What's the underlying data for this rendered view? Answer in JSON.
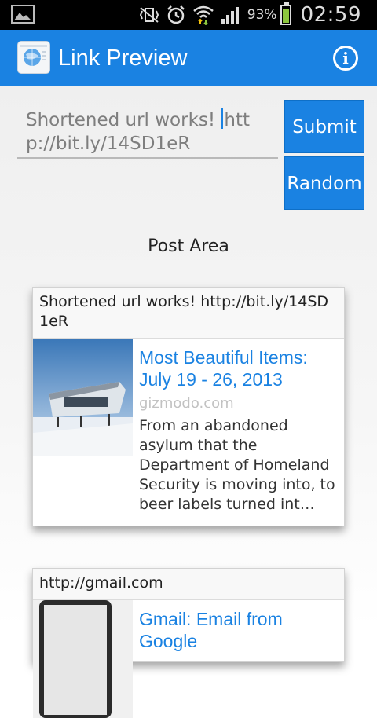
{
  "status_bar": {
    "battery_percent": "93%",
    "time": "02:59"
  },
  "action_bar": {
    "title": "Link Preview"
  },
  "form": {
    "input_value": "Shortened url works! http://bit.ly/14SD1eR",
    "submit_label": "Submit",
    "random_label": "Random"
  },
  "post_area": {
    "title": "Post Area",
    "posts": [
      {
        "text": "Shortened url works! http://bit.ly/14SD1eR",
        "preview_title": "Most Beautiful Items: July 19 - 26, 2013",
        "preview_domain": "gizmodo.com",
        "preview_description": "From an abandoned asylum that the Department of Homeland Security is moving into, to beer labels turned int…"
      },
      {
        "text": "http://gmail.com",
        "preview_title": "Gmail: Email from Google"
      }
    ]
  },
  "colors": {
    "action_bar": "#1a82e2",
    "button": "#1a82e2",
    "link_title": "#1a82e2",
    "battery": "#8dc63f"
  }
}
